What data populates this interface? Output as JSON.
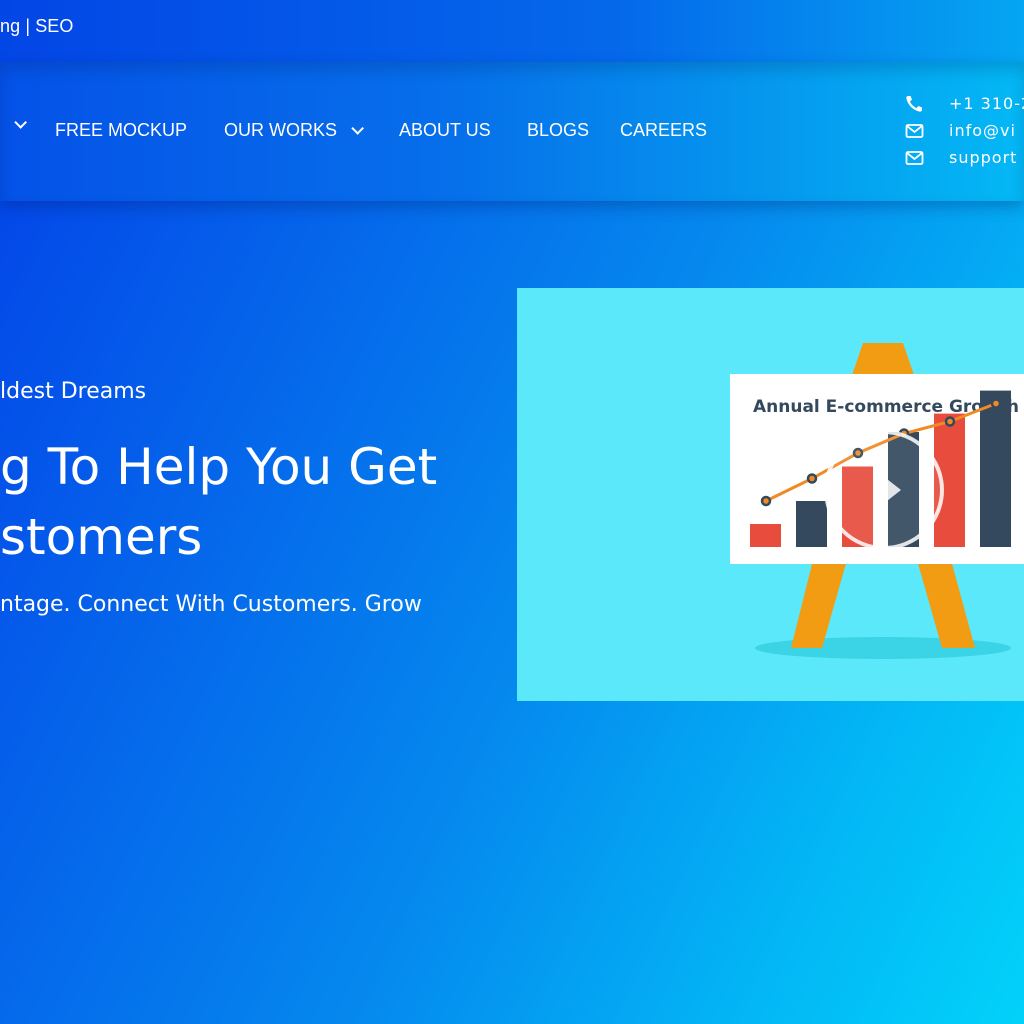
{
  "topbar": {
    "tagline": "ng | SEO"
  },
  "nav": {
    "items": [
      {
        "label": "",
        "has_dropdown": true
      },
      {
        "label": "FREE MOCKUP",
        "has_dropdown": false
      },
      {
        "label": "OUR WORKS",
        "has_dropdown": true
      },
      {
        "label": "ABOUT US",
        "has_dropdown": false
      },
      {
        "label": "BLOGS",
        "has_dropdown": false
      },
      {
        "label": "CAREERS",
        "has_dropdown": false
      }
    ]
  },
  "contacts": [
    {
      "icon": "phone-icon",
      "text": "+1 310-2"
    },
    {
      "icon": "mail-icon",
      "text": "info@vi"
    },
    {
      "icon": "mail-icon",
      "text": "support"
    }
  ],
  "hero": {
    "kicker": "ldest Dreams",
    "title_line1": "g To Help You Get",
    "title_line2": "stomers",
    "subtitle": "ntage. Connect With Customers. Grow"
  },
  "video": {
    "thumbnail_title": "Annual E-commerce Growth",
    "play_icon": "play-icon",
    "colors": {
      "background": "#5CE8FB",
      "easel": "#F29C13",
      "bar_red": "#E74C3C",
      "bar_dark": "#34495E",
      "line": "#F08A24"
    },
    "bars": [
      0.1,
      0.2,
      0.35,
      0.5,
      0.58,
      0.68
    ],
    "trend": [
      0.3,
      0.45,
      0.62,
      0.75,
      0.83,
      0.95
    ]
  },
  "colors": {
    "bg_start": "#0340E8",
    "bg_end": "#02D2FA"
  }
}
